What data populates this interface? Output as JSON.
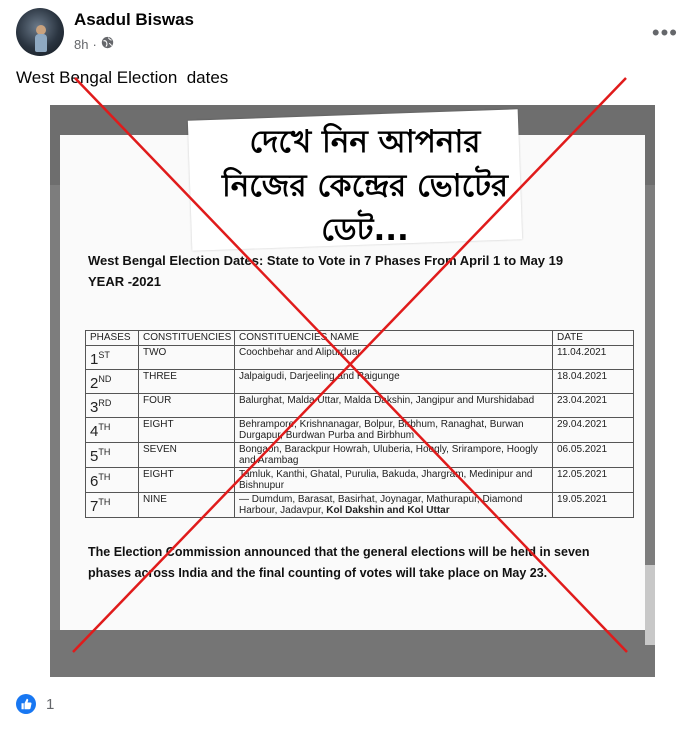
{
  "post": {
    "author": "Asadul Biswas",
    "time": "8h",
    "visibility_icon": "globe-icon",
    "text": "West Bengal Election  dates",
    "more_icon": "ellipsis-icon"
  },
  "image": {
    "headline_line1": "দেখে নিন আপনার",
    "headline_line2": "নিজের কেন্দ্রের ভোটের",
    "headline_line3": "ডেট...",
    "subtitle_line1": "West Bengal Election Dates: State to Vote in 7 Phases From April 1 to May 19",
    "subtitle_line2": "YEAR -2021",
    "table_headers": [
      "PHASES",
      "CONSTITUENCIES",
      "CONSTITUENCIES NAME",
      "DATE"
    ],
    "rows": [
      {
        "phase_num": "1",
        "phase_sup": "ST",
        "count": "TWO",
        "names": "Coochbehar and Alipurduar",
        "date": "11.04.2021"
      },
      {
        "phase_num": "2",
        "phase_sup": "ND",
        "count": "THREE",
        "names": "Jalpaigudi, Darjeeling and Raigunge",
        "date": "18.04.2021"
      },
      {
        "phase_num": "3",
        "phase_sup": "RD",
        "count": "FOUR",
        "names": "Balurghat, Malda Uttar, Malda Dakshin, Jangipur and Murshidabad",
        "date": "23.04.2021"
      },
      {
        "phase_num": "4",
        "phase_sup": "TH",
        "count": "EIGHT",
        "names": "Behrampore, Krishnanagar, Bolpur, Birbhum, Ranaghat, Burwan Durgapur, Burdwan Purba and Birbhum",
        "date": "29.04.2021"
      },
      {
        "phase_num": "5",
        "phase_sup": "TH",
        "count": "SEVEN",
        "names": "Bongaon, Barackpur Howrah, Uluberia, Hoogly, Srirampore, Hoogly and Arambag",
        "date": "06.05.2021"
      },
      {
        "phase_num": "6",
        "phase_sup": "TH",
        "count": "EIGHT",
        "names": "Tamluk, Kanthi, Ghatal, Purulia, Bakuda, Jhargram, Medinipur and Bishnupur",
        "date": "12.05.2021"
      },
      {
        "phase_num": "7",
        "phase_sup": "TH",
        "count": "NINE",
        "names": "— Dumdum, Barasat, Basirhat, Joynagar, Mathurapur, Diamond Harbour, Jadavpur,",
        "names_bold": " Kol Dakshin and Kol Uttar",
        "date": "19.05.2021"
      }
    ],
    "footnote": "The Election Commission announced that the general elections will be held in seven phases across India and the final counting of votes will take place on May 23.",
    "overlay_color": "#e01b1b"
  },
  "reactions": {
    "icon": "thumbs-up-icon",
    "count": "1"
  }
}
